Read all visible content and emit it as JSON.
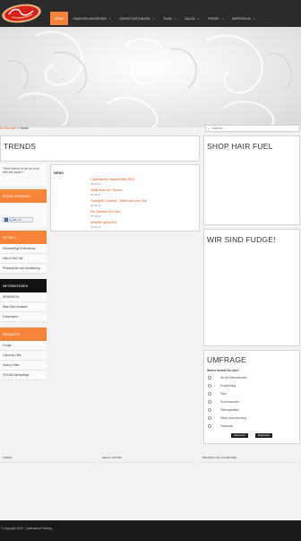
{
  "header": {
    "logo_text": "Cake",
    "nav": [
      {
        "label": "HOME",
        "active": true,
        "has_arrow": false
      },
      {
        "label": "HAARVERLÄNGERUNG",
        "active": false,
        "has_arrow": true
      },
      {
        "label": "DIENSTLEISTUNGEN",
        "active": false,
        "has_arrow": true
      },
      {
        "label": "TEAM",
        "active": false,
        "has_arrow": true
      },
      {
        "label": "SALON",
        "active": false,
        "has_arrow": true
      },
      {
        "label": "PREISE",
        "active": false,
        "has_arrow": true
      },
      {
        "label": "IMPRESSUM",
        "active": false,
        "has_arrow": true
      }
    ]
  },
  "breadcrumb": {
    "link": "Du bist hier:",
    "sep": "»",
    "current": "Home"
  },
  "search": {
    "placeholder": "Suchen..."
  },
  "sidebar": {
    "intro_text": "There seems to be an error with the player !",
    "social_head": "SOCIAL NETWORK",
    "facebook_label": "Gefällt mir",
    "aktuell_head": "AKTUELL",
    "aktuell_links": [
      "Hochwertige Extensions",
      "Hair in the City",
      "Philosophie und Ausbildung"
    ],
    "info_head": "INFORMATIONEN",
    "info_links": [
      "NEWSSEAL",
      "Was Dich erwartet",
      "Gutscheine"
    ],
    "produkte_head": "PRODUKTE",
    "produkte_links": [
      "Fudge",
      "I Beverly Hills",
      "Heavy Hitter",
      "CELEB Handpflege"
    ]
  },
  "main": {
    "trends_title": "TRENDS",
    "news_label": "NEWS",
    "news": [
      {
        "title": "Cakesalons Haartrends 2012",
        "date": "09.08.12"
      },
      {
        "title": "Stellt sich vor: Daniel",
        "date": "09.08.12"
      },
      {
        "title": "Hairstyle-Contest - Stellt sich vor: Ela",
        "date": "09.08.12"
      },
      {
        "title": "Ein Gewinn für Dich",
        "date": "27.08.12"
      },
      {
        "title": "Modelle gesucht!",
        "date": "27.08.12"
      }
    ]
  },
  "right": {
    "shop_title": "SHOP HAIR FUEL",
    "fudge_title": "WIR SIND FUDGE!",
    "poll": {
      "title": "UMFRAGE",
      "question": "Woher kennst Du uns?",
      "options": [
        "Ich bin Stammkundin",
        "Empfehlung",
        "Flyer",
        "Suchmaschine",
        "Zeitungsartikel",
        "Salon Auszeichnung",
        "Facebook"
      ],
      "vote_label": "Abstimmen",
      "results_label": "Ergebnisse"
    }
  },
  "footer": {
    "columns": [
      "FUDGE",
      "HEAVY HITTER",
      "I BEVERLY HILLS PARTNER"
    ],
    "copyright": "© Copyright 2012 - Cakesalons Freiburg"
  },
  "colors": {
    "accent": "#f5843a",
    "link": "#e05b18",
    "dark": "#2b2b2b",
    "bg": "#f2f2f2"
  }
}
